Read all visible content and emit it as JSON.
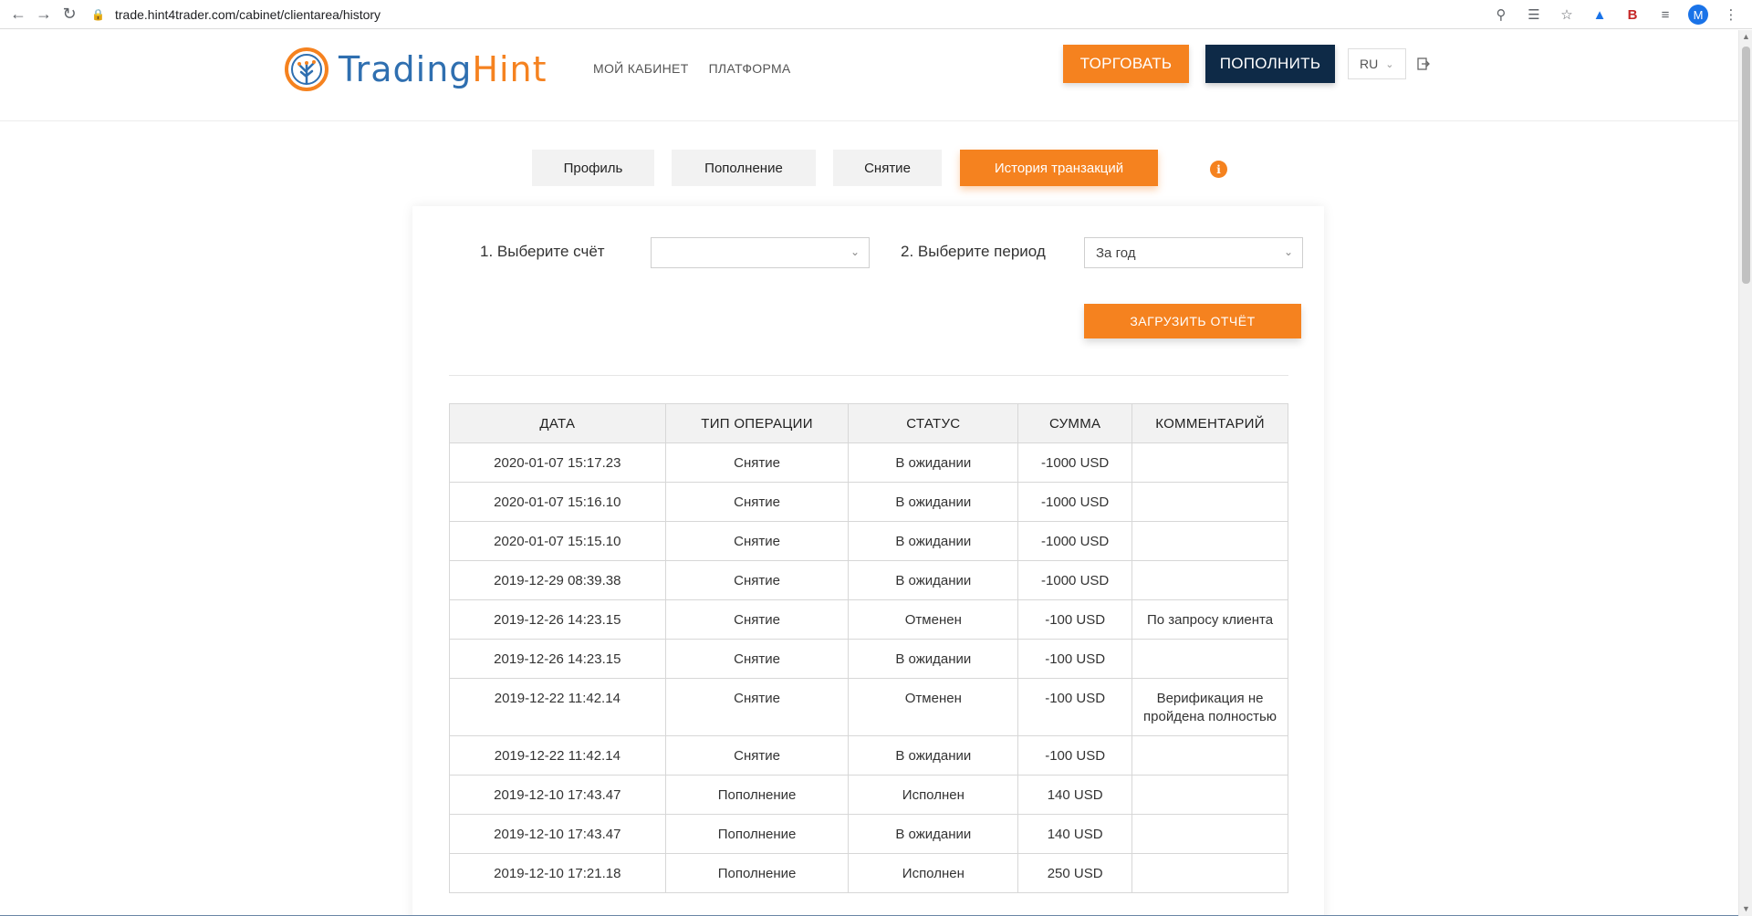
{
  "browser": {
    "url": "trade.hint4trader.com/cabinet/clientarea/history",
    "profile_initial": "M",
    "icons": [
      "back-icon",
      "forward-icon",
      "reload-icon",
      "lock-icon",
      "key-icon",
      "translate-icon",
      "star-icon",
      "extension-icon",
      "bookmark-icon",
      "reading-list-icon",
      "menu-icon"
    ]
  },
  "header": {
    "logo_part1": "Trading",
    "logo_part2": "Hint",
    "nav": [
      "МОЙ КАБИНЕТ",
      "ПЛАТФОРМА"
    ],
    "trade_label": "ТОРГОВАТЬ",
    "deposit_label": "ПОПОЛНИТЬ",
    "lang": "RU"
  },
  "tabs": [
    "Профиль",
    "Пополнение",
    "Снятие",
    "История транзакций"
  ],
  "info_glyph": "i",
  "filters": {
    "account_label": "1. Выберите счёт",
    "account_value": "",
    "period_label": "2. Выберите период",
    "period_value": "За год",
    "report_button": "ЗАГРУЗИТЬ ОТЧЁТ"
  },
  "table": {
    "headers": [
      "ДАТА",
      "ТИП ОПЕРАЦИИ",
      "СТАТУС",
      "СУММА",
      "КОММЕНТАРИЙ"
    ],
    "rows": [
      [
        "2020-01-07 15:17.23",
        "Снятие",
        "В ожидании",
        "-1000 USD",
        ""
      ],
      [
        "2020-01-07 15:16.10",
        "Снятие",
        "В ожидании",
        "-1000 USD",
        ""
      ],
      [
        "2020-01-07 15:15.10",
        "Снятие",
        "В ожидании",
        "-1000 USD",
        ""
      ],
      [
        "2019-12-29 08:39.38",
        "Снятие",
        "В ожидании",
        "-1000 USD",
        ""
      ],
      [
        "2019-12-26 14:23.15",
        "Снятие",
        "Отменен",
        "-100 USD",
        "По запросу клиента"
      ],
      [
        "2019-12-26 14:23.15",
        "Снятие",
        "В ожидании",
        "-100 USD",
        ""
      ],
      [
        "2019-12-22 11:42.14",
        "Снятие",
        "Отменен",
        "-100 USD",
        "Верификация не пройдена полностью"
      ],
      [
        "2019-12-22 11:42.14",
        "Снятие",
        "В ожидании",
        "-100 USD",
        ""
      ],
      [
        "2019-12-10 17:43.47",
        "Пополнение",
        "Исполнен",
        "140 USD",
        ""
      ],
      [
        "2019-12-10 17:43.47",
        "Пополнение",
        "В ожидании",
        "140 USD",
        ""
      ],
      [
        "2019-12-10 17:21.18",
        "Пополнение",
        "Исполнен",
        "250 USD",
        ""
      ]
    ]
  },
  "colors": {
    "accent": "#f5821f",
    "dark": "#0e2a47",
    "logo_blue": "#2f6fb0"
  }
}
